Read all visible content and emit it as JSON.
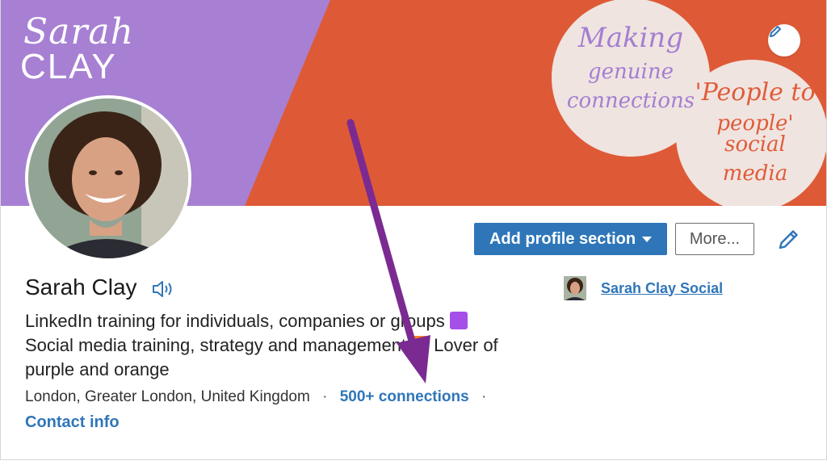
{
  "banner": {
    "logo_script": "Sarah",
    "logo_block": "CLAY",
    "circle1": {
      "line1": "Making",
      "line2": "genuine",
      "line3": "connections"
    },
    "circle2": {
      "line1": "'People to",
      "line2": "people' social",
      "line3": "media"
    },
    "colors": {
      "purple": "#a780d3",
      "orange": "#de5a36",
      "circle": "#f0e4e0"
    }
  },
  "actions": {
    "add_section_label": "Add profile section",
    "more_label": "More..."
  },
  "profile": {
    "name": "Sarah Clay",
    "headline_1": "LinkedIn training for individuals, companies or groups",
    "headline_2": "Social media training, strategy and management",
    "headline_3": "Lover of",
    "headline_4": "purple and orange",
    "location": "London, Greater London, United Kingdom",
    "connections": "500+ connections",
    "contact_info": "Contact info"
  },
  "company": {
    "name": "Sarah Clay Social"
  },
  "icons": {
    "edit_cover": "pencil-icon",
    "edit_intro": "pencil-icon",
    "pronunciation": "speaker-icon",
    "dropdown": "caret-down-icon"
  },
  "accent_color": "#2f76b9",
  "annotation_color": "#7b2a92"
}
